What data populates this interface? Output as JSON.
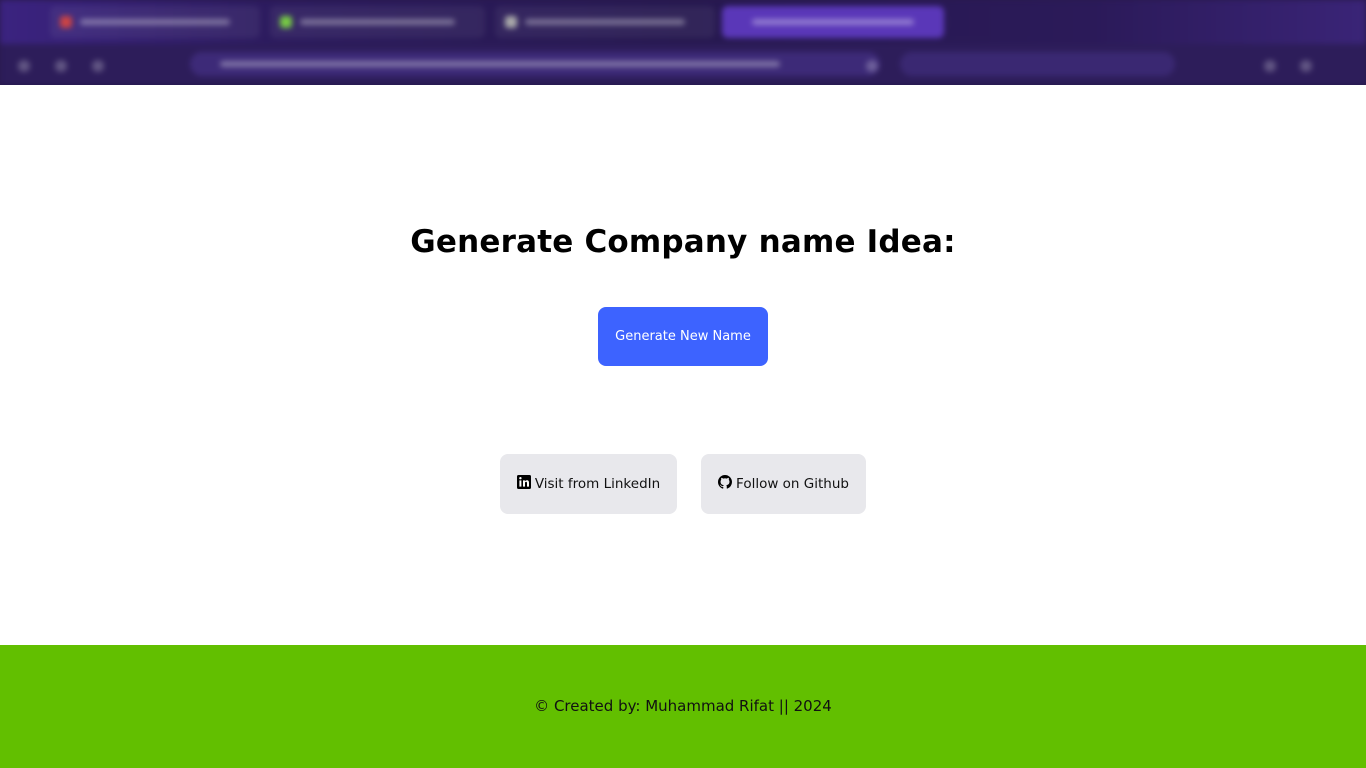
{
  "main": {
    "title": "Generate Company name Idea:",
    "generate_button_label": "Generate New Name"
  },
  "social": {
    "linkedin_label": "Visit from LinkedIn",
    "github_label": "Follow on Github"
  },
  "footer": {
    "text": "© Created by: Muhammad Rifat || 2024"
  },
  "colors": {
    "primary_button": "#3d63ff",
    "social_button": "#e8e8ec",
    "footer_bg": "#62bf00"
  },
  "icons": {
    "linkedin": "linkedin-icon",
    "github": "github-icon"
  }
}
